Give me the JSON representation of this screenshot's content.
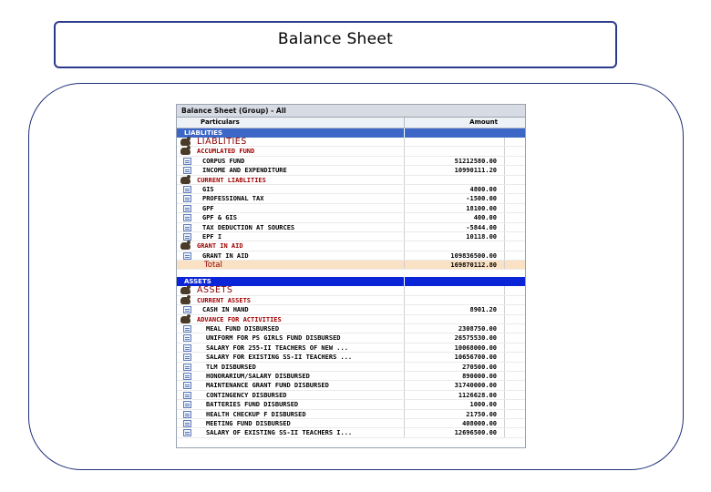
{
  "slide": {
    "title": "Balance Sheet"
  },
  "window": {
    "title": "Balance Sheet (Group) - All",
    "columns": {
      "particulars": "Particulars",
      "amount": "Amount"
    }
  },
  "liabilities_bar": "LIABLITIES",
  "liabilities_heading": "LIABLITIES",
  "liabilities_rows": [
    {
      "label": "ACCUMLATED FUND",
      "amount": "",
      "kind": "group",
      "icon": "hand-icon"
    },
    {
      "label": "CORPUS FUND",
      "amount": "51212580.00",
      "kind": "item",
      "icon": "document-icon"
    },
    {
      "label": "INCOME AND EXPENDITURE",
      "amount": "10990111.20",
      "kind": "item",
      "icon": "document-icon"
    },
    {
      "label": "CURRENT LIABLITIES",
      "amount": "",
      "kind": "group",
      "icon": "hand-icon"
    },
    {
      "label": "GIS",
      "amount": "4800.00",
      "kind": "item",
      "icon": "document-icon"
    },
    {
      "label": "PROFESSIONAL TAX",
      "amount": "-1500.00",
      "kind": "item",
      "icon": "document-icon"
    },
    {
      "label": "GPF",
      "amount": "18100.00",
      "kind": "item",
      "icon": "document-icon"
    },
    {
      "label": "GPF & GIS",
      "amount": "400.00",
      "kind": "item",
      "icon": "document-icon"
    },
    {
      "label": "TAX DEDUCTION AT SOURCES",
      "amount": "-5844.00",
      "kind": "item",
      "icon": "document-icon"
    },
    {
      "label": "EPF I",
      "amount": "10118.00",
      "kind": "item",
      "icon": "document-icon"
    },
    {
      "label": "GRANT IN AID",
      "amount": "",
      "kind": "group",
      "icon": "hand-icon"
    },
    {
      "label": "GRANT IN AID",
      "amount": "109836500.00",
      "kind": "item",
      "icon": "document-icon"
    }
  ],
  "total": {
    "label": "Total",
    "amount": "169870112.80"
  },
  "assets_bar": "ASSETS",
  "assets_heading": "ASSETS",
  "assets_rows": [
    {
      "label": "CURRENT ASSETS",
      "amount": "",
      "kind": "group",
      "icon": "hand-icon"
    },
    {
      "label": "CASH IN HAND",
      "amount": "8901.20",
      "kind": "item",
      "icon": "document-icon"
    },
    {
      "label": "ADVANCE FOR ACTIVITIES",
      "amount": "",
      "kind": "group",
      "icon": "hand-icon"
    },
    {
      "label": "MEAL FUND DISBURSED",
      "amount": "2308750.00",
      "kind": "item2",
      "icon": "document-icon"
    },
    {
      "label": "UNIFORM FOR PS GIRLS FUND DISBURSED",
      "amount": "26575530.00",
      "kind": "item2",
      "icon": "document-icon"
    },
    {
      "label": "SALARY FOR 255-II TEACHERS OF NEW ...",
      "amount": "10068000.00",
      "kind": "item2",
      "icon": "document-icon"
    },
    {
      "label": "SALARY FOR EXISTING SS-II TEACHERS ...",
      "amount": "10656700.00",
      "kind": "item2",
      "icon": "document-icon"
    },
    {
      "label": "TLM DISBURSED",
      "amount": "270500.00",
      "kind": "item2",
      "icon": "document-icon"
    },
    {
      "label": "HONORARIUM/SALARY DISBURSED",
      "amount": "890000.00",
      "kind": "item2",
      "icon": "document-icon"
    },
    {
      "label": "MAINTENANCE GRANT FUND DISBURSED",
      "amount": "31740000.00",
      "kind": "item2",
      "icon": "document-icon"
    },
    {
      "label": "CONTINGENCY DISBURSED",
      "amount": "1126628.00",
      "kind": "item2",
      "icon": "document-icon"
    },
    {
      "label": "BATTERIES FUND DISBURSED",
      "amount": "1000.00",
      "kind": "item2",
      "icon": "document-icon"
    },
    {
      "label": "HEALTH CHECKUP F DISBURSED",
      "amount": "21750.00",
      "kind": "item2",
      "icon": "document-icon"
    },
    {
      "label": "MEETING FUND DISBURSED",
      "amount": "408000.00",
      "kind": "item2",
      "icon": "document-icon"
    },
    {
      "label": "SALARY OF EXISTING SS-II TEACHERS I...",
      "amount": "12696500.00",
      "kind": "item2",
      "icon": "document-icon"
    }
  ]
}
